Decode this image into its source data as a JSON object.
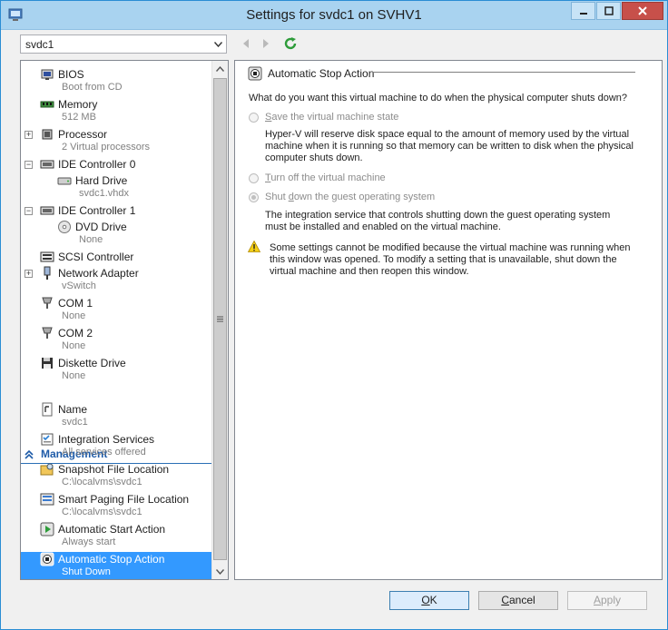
{
  "window": {
    "title": "Settings for svdc1 on SVHV1",
    "vm_selector": "svdc1"
  },
  "tree": {
    "items": [
      {
        "label": "BIOS",
        "sub": "Boot from CD",
        "icon": "bios-icon"
      },
      {
        "label": "Memory",
        "sub": "512 MB",
        "icon": "memory-icon"
      },
      {
        "label": "Processor",
        "sub": "2 Virtual processors",
        "icon": "processor-icon"
      },
      {
        "label": "IDE Controller 0",
        "sub": "",
        "icon": "ide-controller-icon"
      },
      {
        "label": "Hard Drive",
        "sub": "svdc1.vhdx",
        "icon": "hard-drive-icon"
      },
      {
        "label": "IDE Controller 1",
        "sub": "",
        "icon": "ide-controller-icon"
      },
      {
        "label": "DVD Drive",
        "sub": "None",
        "icon": "dvd-drive-icon"
      },
      {
        "label": "SCSI Controller",
        "sub": "",
        "icon": "scsi-controller-icon"
      },
      {
        "label": "Network Adapter",
        "sub": "vSwitch",
        "icon": "network-adapter-icon"
      },
      {
        "label": "COM 1",
        "sub": "None",
        "icon": "com-port-icon"
      },
      {
        "label": "COM 2",
        "sub": "None",
        "icon": "com-port-icon"
      },
      {
        "label": "Diskette Drive",
        "sub": "None",
        "icon": "diskette-drive-icon"
      }
    ],
    "management_label": "Management",
    "management_items": [
      {
        "label": "Name",
        "sub": "svdc1",
        "icon": "name-icon"
      },
      {
        "label": "Integration Services",
        "sub": "All services offered",
        "icon": "integration-services-icon"
      },
      {
        "label": "Snapshot File Location",
        "sub": "C:\\localvms\\svdc1",
        "icon": "snapshot-location-icon"
      },
      {
        "label": "Smart Paging File Location",
        "sub": "C:\\localvms\\svdc1",
        "icon": "smart-paging-icon"
      },
      {
        "label": "Automatic Start Action",
        "sub": "Always start",
        "icon": "automatic-start-icon"
      },
      {
        "label": "Automatic Stop Action",
        "sub": "Shut Down",
        "icon": "automatic-stop-icon",
        "selected": true
      }
    ]
  },
  "detail": {
    "heading": "Automatic Stop Action",
    "question": "What do you want this virtual machine to do when the physical computer shuts down?",
    "options": [
      {
        "label": "Save the virtual machine state",
        "checked": false,
        "description": [
          "Hyper-V will reserve disk space equal to the amount of memory used by the virtual",
          "machine when it is running so that memory can be written to disk when the physical",
          "computer shuts down."
        ]
      },
      {
        "label": "Turn off the virtual machine",
        "checked": false,
        "description": []
      },
      {
        "label": "Shut down the guest operating system",
        "checked": true,
        "description": [
          "The integration service that controls shutting down the guest operating system",
          "must be installed and enabled on the virtual machine."
        ]
      }
    ],
    "warning": [
      "Some settings cannot be modified because the virtual machine was running when",
      "this window was opened. To modify a setting that is unavailable, shut down the",
      "virtual machine and then reopen this window."
    ]
  },
  "buttons": {
    "ok": "OK",
    "cancel": "Cancel",
    "apply": "Apply"
  },
  "colors": {
    "titlebar": "#a9d3f0",
    "selection": "#3399ff",
    "section": "#1e5ba8",
    "close": "#c7504a"
  }
}
